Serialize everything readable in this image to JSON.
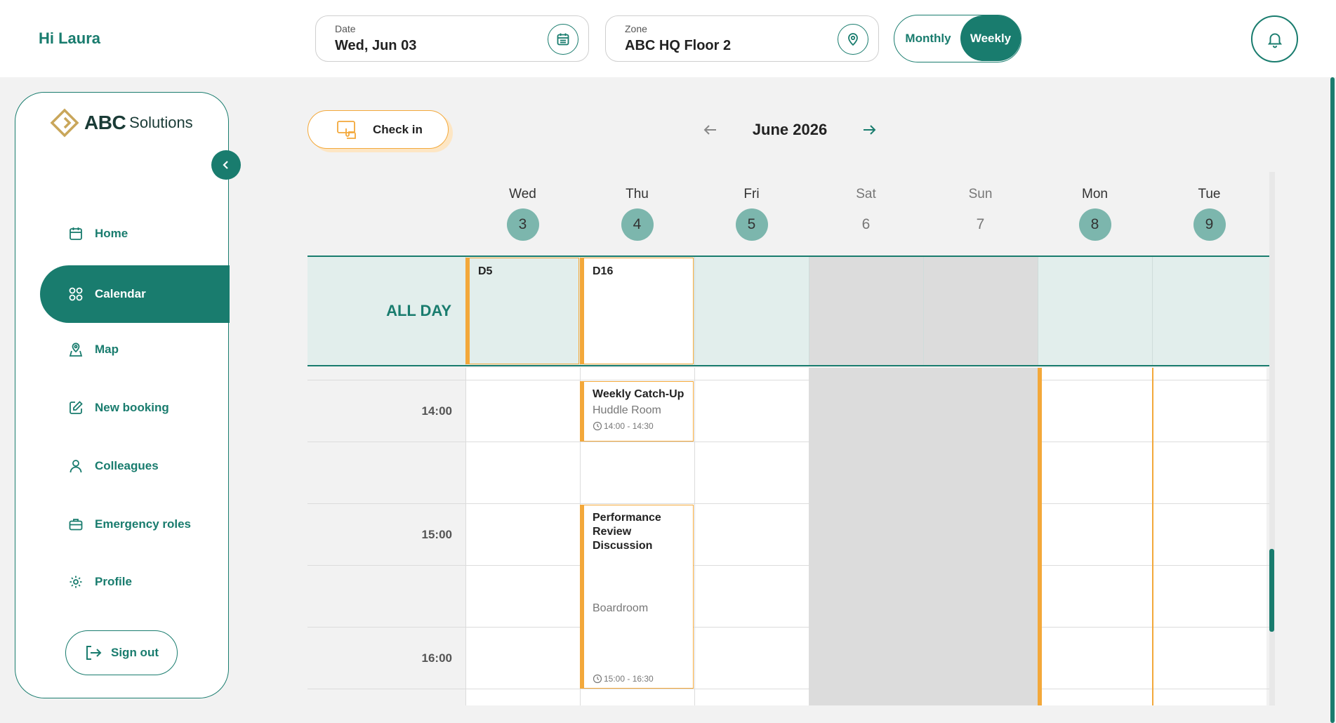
{
  "header": {
    "greeting": "Hi Laura",
    "date_label": "Date",
    "date_value": "Wed, Jun 03",
    "zone_label": "Zone",
    "zone_value": "ABC HQ Floor 2",
    "view_monthly": "Monthly",
    "view_weekly": "Weekly",
    "view_selected": "Weekly"
  },
  "brand": {
    "name_main": "ABC",
    "name_sub": "Solutions",
    "accent_color": "#197c6e",
    "highlight_color": "#f3a83a"
  },
  "sidebar": {
    "items": [
      {
        "label": "Home",
        "icon": "calendar-icon"
      },
      {
        "label": "Calendar",
        "icon": "grid-icon",
        "active": true
      },
      {
        "label": "Map",
        "icon": "map-pin-icon"
      },
      {
        "label": "New booking",
        "icon": "edit-icon"
      },
      {
        "label": "Colleagues",
        "icon": "person-icon"
      },
      {
        "label": "Emergency roles",
        "icon": "briefcase-icon"
      },
      {
        "label": "Profile",
        "icon": "gear-icon"
      }
    ],
    "signout_label": "Sign out"
  },
  "calendar": {
    "checkin_label": "Check in",
    "month_title": "June 2026",
    "allday_label": "ALL DAY",
    "days": [
      {
        "name": "Wed",
        "num": "3",
        "workday": true
      },
      {
        "name": "Thu",
        "num": "4",
        "workday": true
      },
      {
        "name": "Fri",
        "num": "5",
        "workday": true
      },
      {
        "name": "Sat",
        "num": "6",
        "workday": false
      },
      {
        "name": "Sun",
        "num": "7",
        "workday": false
      },
      {
        "name": "Mon",
        "num": "8",
        "workday": true
      },
      {
        "name": "Tue",
        "num": "9",
        "workday": true
      }
    ],
    "allday_bookings": [
      {
        "day": "Wed",
        "label": "D5"
      },
      {
        "day": "Thu",
        "label": "D16"
      }
    ],
    "times": [
      "14:00",
      "15:00",
      "16:00"
    ],
    "events": [
      {
        "day": "Thu",
        "title": "Weekly Catch-Up",
        "location": "Huddle Room",
        "time": "14:00 - 14:30"
      },
      {
        "day": "Thu",
        "title": "Performance Review Discussion",
        "location": "Boardroom",
        "time": "15:00 - 16:30"
      }
    ]
  }
}
